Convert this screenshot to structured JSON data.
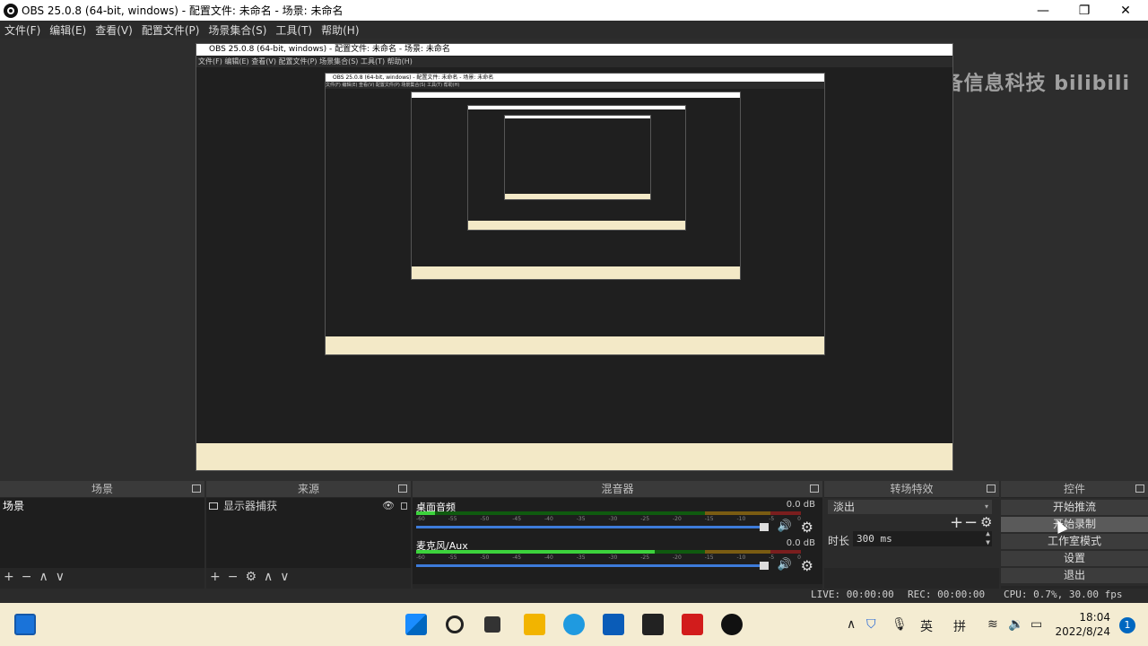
{
  "window": {
    "title": "OBS 25.0.8 (64-bit, windows) - 配置文件: 未命名 - 场景: 未命名",
    "minimize": "—",
    "maximize": "❐",
    "close": "✕"
  },
  "menu": [
    "文件(F)",
    "编辑(E)",
    "查看(V)",
    "配置文件(P)",
    "场景集合(S)",
    "工具(T)",
    "帮助(H)"
  ],
  "watermark": "图宁完备信息科技 bilibili",
  "docks": {
    "scenes": {
      "title": "场景",
      "items": [
        "场景"
      ],
      "tools": [
        "+",
        "−",
        "∧",
        "∨"
      ]
    },
    "sources": {
      "title": "来源",
      "items": [
        "显示器捕获"
      ],
      "tools": [
        "+",
        "−",
        "⚙",
        "∧",
        "∨"
      ]
    },
    "mixer": {
      "title": "混音器",
      "tracks": [
        {
          "name": "桌面音频",
          "db": "0.0 dB",
          "level": 0.05
        },
        {
          "name": "麦克风/Aux",
          "db": "0.0 dB",
          "level": 0.62
        }
      ]
    },
    "transitions": {
      "title": "转场特效",
      "selected": "淡出",
      "duration_label": "时长",
      "duration_value": "300 ms"
    },
    "controls": {
      "title": "控件",
      "buttons": [
        "开始推流",
        "开始录制",
        "工作室模式",
        "设置",
        "退出"
      ]
    }
  },
  "status": {
    "live": "LIVE: 00:00:00",
    "rec": "REC: 00:00:00",
    "cpu": "CPU: 0.7%, 30.00 fps"
  },
  "taskbar": {
    "tray_lang1": "英",
    "tray_lang2": "拼",
    "time": "18:04",
    "date": "2022/8/24",
    "notifications": "1"
  },
  "colors": {
    "accent": "#3d7bd9",
    "meter_green": "#3cd23c",
    "taskbar_bg": "#f4ecd2"
  }
}
